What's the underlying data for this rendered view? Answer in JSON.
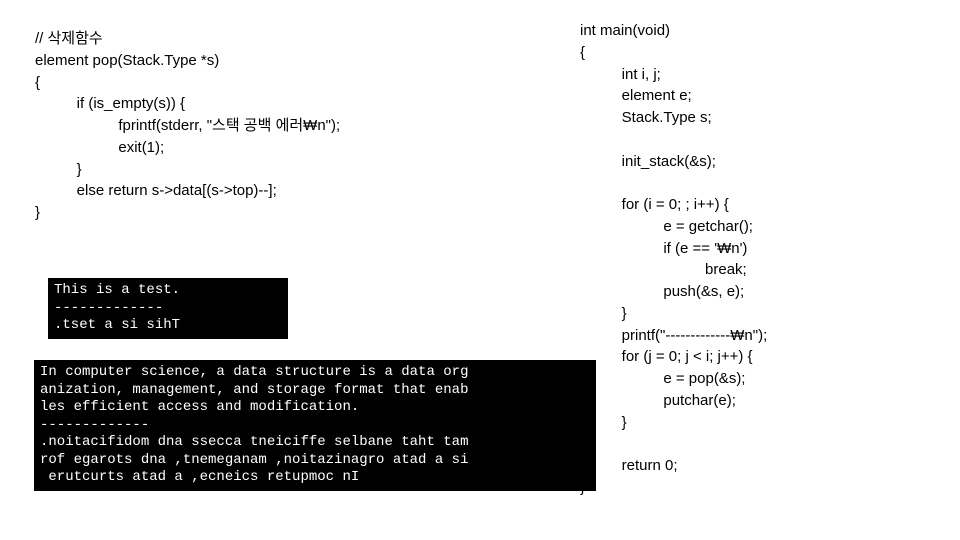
{
  "left_code": "// 삭제함수\nelement pop(Stack.Type *s)\n{\n          if (is_empty(s)) {\n                    fprintf(stderr, \"스택 공백 에러₩n\");\n                    exit(1);\n          }\n          else return s->data[(s->top)--];\n}",
  "right_code": "int main(void)\n{\n          int i, j;\n          element e;\n          Stack.Type s;\n\n          init_stack(&s);\n\n          for (i = 0; ; i++) {\n                    e = getchar();\n                    if (e == '₩n')\n                              break;\n                    push(&s, e);\n          }\n          printf(\"-------------₩n\");\n          for (j = 0; j < i; j++) {\n                    e = pop(&s);\n                    putchar(e);\n          }\n\n          return 0;\n}",
  "terminal1": "This is a test.\n-------------\n.tset a si sihT",
  "terminal2": "In computer science, a data structure is a data org\nanization, management, and storage format that enab\nles efficient access and modification.\n-------------\n.noitacifidom dna ssecca tneiciffe selbane taht tam\nrof egarots dna ,tnemeganam ,noitazinagro atad a si\n erutcurts atad a ,ecneics retupmoc nI"
}
